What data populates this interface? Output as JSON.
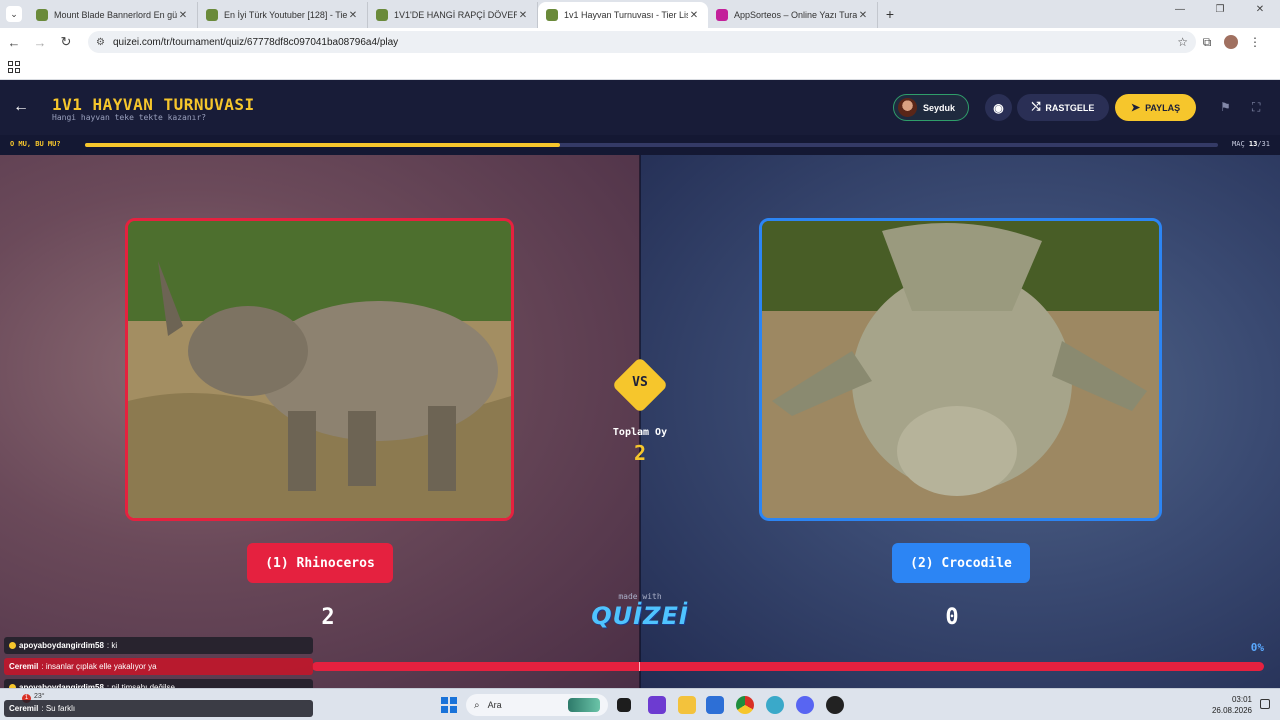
{
  "browser": {
    "tabs": [
      {
        "title": "Mount Blade Bannerlord En gü",
        "color": "#6a8a3a",
        "active": false
      },
      {
        "title": "En İyi Türk Youtuber [128] - Tier",
        "color": "#6a8a3a",
        "active": false
      },
      {
        "title": "1V1'DE HANGİ RAPÇİ DÖVER -",
        "color": "#6a8a3a",
        "active": false
      },
      {
        "title": "1v1 Hayvan Turnuvası - Tier List",
        "color": "#6a8a3a",
        "active": true
      },
      {
        "title": "AppSorteos – Online Yazı Tura",
        "color": "#c3209a",
        "active": false
      }
    ],
    "url": "quizei.com/tr/tournament/quiz/67778df8c097041ba08796a4/play"
  },
  "quiz": {
    "title": "1V1 HAYVAN TURNUVASI",
    "subtitle": "Hangi hayvan teke tekte kazanır?",
    "user_name": "Seyduk",
    "random_label": "RASTGELE",
    "share_label": "PAYLAŞ",
    "progress_label": "O MU, BU MU?",
    "progress_fraction": 0.4194,
    "match_label": "MAÇ",
    "match_current": "13",
    "match_total": "/31"
  },
  "arena": {
    "left": {
      "name": "(1) Rhinoceros",
      "votes": "2",
      "color": "#e5213f"
    },
    "right": {
      "name": "(2) Crocodile",
      "votes": "0",
      "color": "#2c85f4"
    },
    "vs_label": "VS",
    "total_label": "Toplam Oy",
    "total_value": "2",
    "made_with": "made with",
    "brand": "QUİZEİ",
    "percent": "0%"
  },
  "chat": [
    {
      "nick": "apoyaboydangirdim58",
      "msg": "ki",
      "style": "dark"
    },
    {
      "nick": "Ceremil",
      "msg": "insanlar çıplak elle yakalıyor ya",
      "style": "red"
    },
    {
      "nick": "apoyaboydangirdim58",
      "msg": "nil timsahı değilse",
      "style": "dark"
    },
    {
      "nick": "Ceremil",
      "msg": "Su farklı",
      "style": "dark"
    }
  ],
  "taskbar": {
    "search_placeholder": "Ara",
    "time": "03:01",
    "date": "26.08.2026",
    "weather_badge": "1",
    "weather_temp": "23°"
  }
}
